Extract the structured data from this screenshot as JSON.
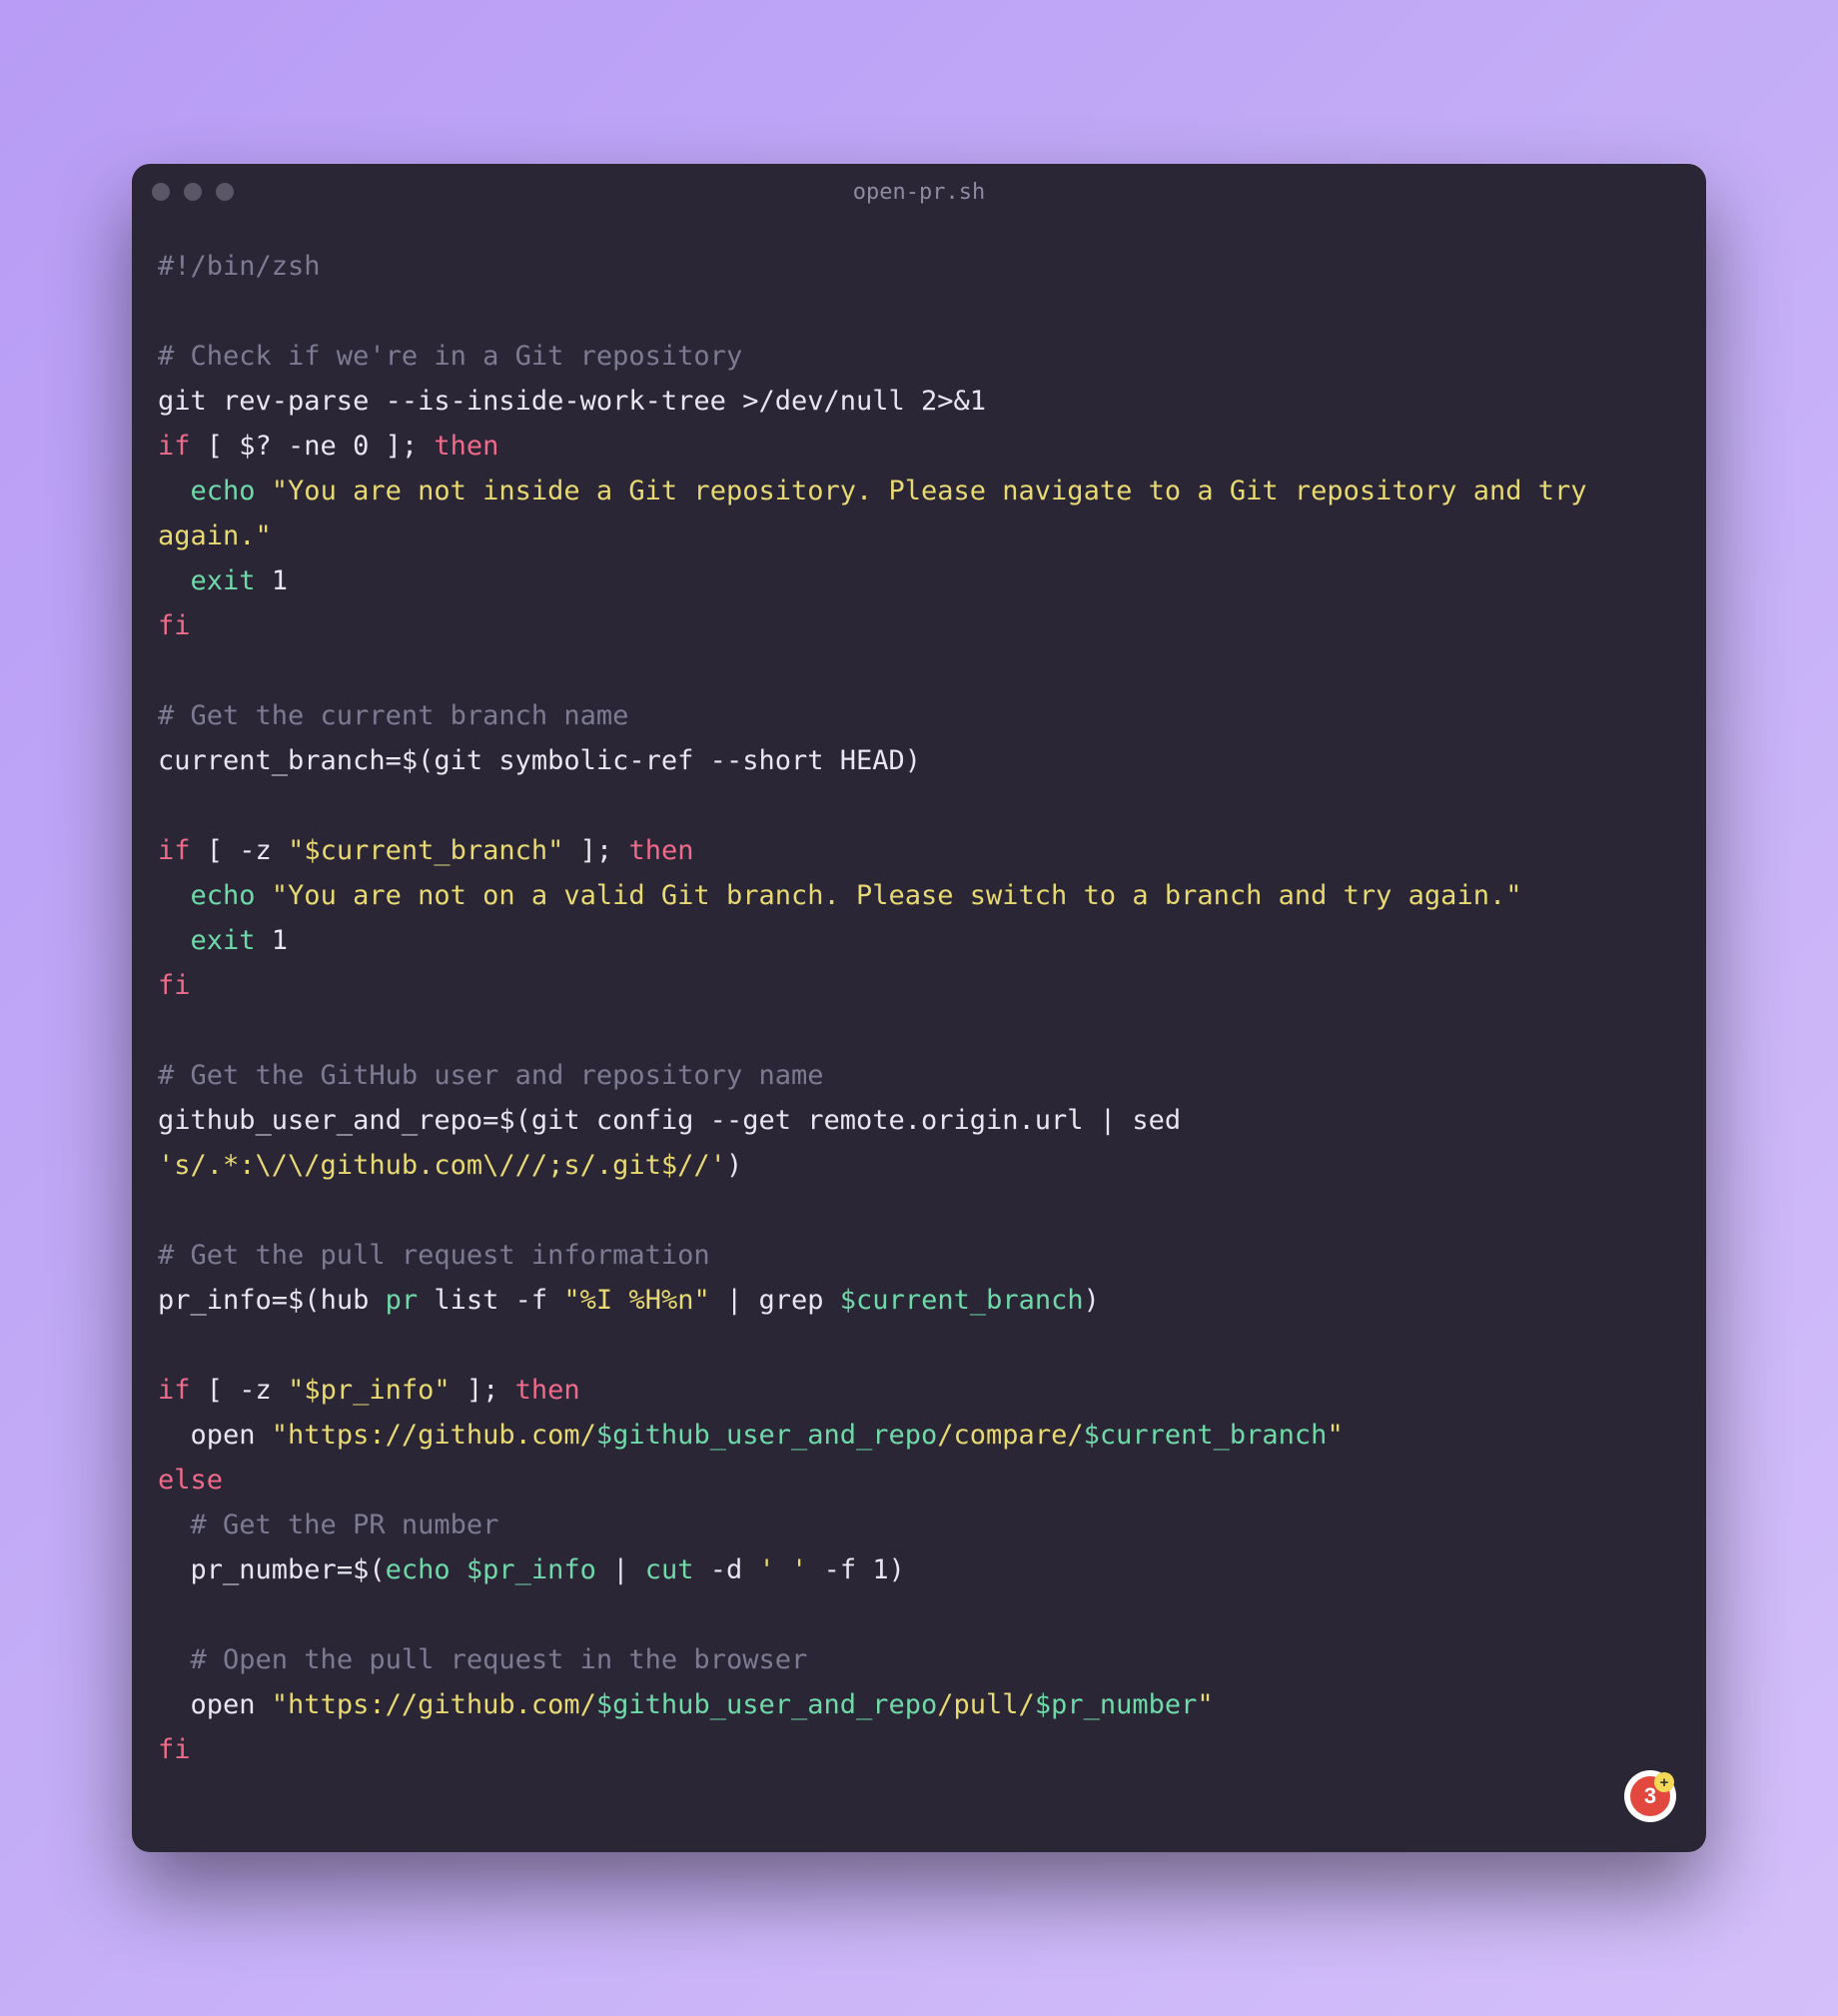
{
  "window": {
    "filename": "open-pr.sh"
  },
  "badge": {
    "count": "3",
    "plus": "+"
  },
  "code": {
    "l1_shebang": "#!/bin/zsh",
    "l3_comment": "# Check if we're in a Git repository",
    "l4_cmd": "git rev-parse --is-inside-work-tree >/dev/null 2>&1",
    "l5_if": "if",
    "l5_cond": " [ $? -ne 0 ]; ",
    "l5_then": "then",
    "l6_echo": "  echo ",
    "l6_str": "\"You are not inside a Git repository. Please navigate to a Git repository and try again.\"",
    "l7_exit": "  exit",
    "l7_code": " 1",
    "l8_fi": "fi",
    "l10_comment": "# Get the current branch name",
    "l11_a": "current_branch=$(",
    "l11_b": "git symbolic-ref --short HEAD",
    "l11_c": ")",
    "l13_if": "if",
    "l13_cond_a": " [ -z ",
    "l13_str": "\"$current_branch\"",
    "l13_cond_b": " ]; ",
    "l13_then": "then",
    "l14_echo": "  echo ",
    "l14_str": "\"You are not on a valid Git branch. Please switch to a branch and try again.\"",
    "l15_exit": "  exit",
    "l15_code": " 1",
    "l16_fi": "fi",
    "l18_comment": "# Get the GitHub user and repository name",
    "l19_a": "github_user_and_repo=$(",
    "l19_b": "git config --get remote.origin.url",
    "l19_c": " | ",
    "l19_d": "sed ",
    "l19_e": "'s/.*:\\/\\/github.com\\///;s/.git$//'",
    "l19_f": ")",
    "l21_comment": "# Get the pull request information",
    "l22_a": "pr_info=$(",
    "l22_b": "hub ",
    "l22_c": "pr",
    "l22_d": " list -f ",
    "l22_e": "\"%I %H%n\"",
    "l22_f": " | ",
    "l22_g": "grep ",
    "l22_h": "$current_branch",
    "l22_i": ")",
    "l24_if": "if",
    "l24_cond_a": " [ -z ",
    "l24_str": "\"$pr_info\"",
    "l24_cond_b": " ]; ",
    "l24_then": "then",
    "l25_open": "  open ",
    "l25_s1": "\"https://github.com/",
    "l25_v1": "$github_user_and_repo",
    "l25_s2": "/compare/",
    "l25_v2": "$current_branch",
    "l25_s3": "\"",
    "l26_else": "else",
    "l27_comment": "  # Get the PR number",
    "l28_a": "  pr_number=$(",
    "l28_b": "echo",
    "l28_c": " ",
    "l28_d": "$pr_info",
    "l28_e": " | ",
    "l28_f": "cut",
    "l28_g": " -d ",
    "l28_h": "' '",
    "l28_i": " -f 1)",
    "l30_comment": "  # Open the pull request in the browser",
    "l31_open": "  open ",
    "l31_s1": "\"https://github.com/",
    "l31_v1": "$github_user_and_repo",
    "l31_s2": "/pull/",
    "l31_v2": "$pr_number",
    "l31_s3": "\"",
    "l32_fi": "fi"
  }
}
